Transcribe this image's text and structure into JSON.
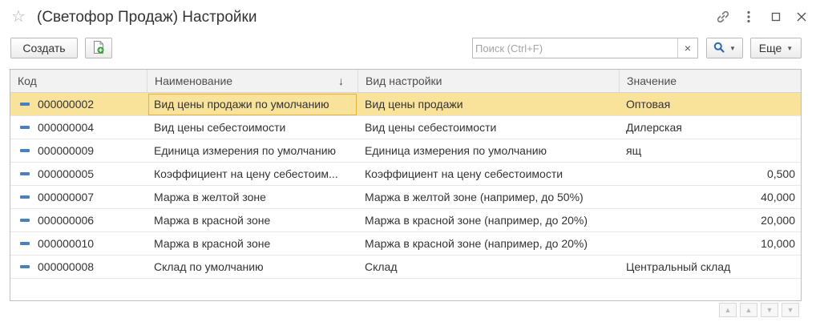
{
  "window": {
    "title": "(Светофор Продаж) Настройки"
  },
  "toolbar": {
    "create_label": "Создать",
    "search_placeholder": "Поиск (Ctrl+F)",
    "search_value": "",
    "clear_symbol": "×",
    "more_label": "Еще"
  },
  "table": {
    "columns": [
      "Код",
      "Наименование",
      "Вид настройки",
      "Значение"
    ],
    "sort_indicator": "↓",
    "rows": [
      {
        "code": "000000002",
        "name": "Вид цены продажи по умолчанию",
        "type": "Вид цены продажи",
        "value": "Оптовая",
        "numeric": false,
        "selected": true
      },
      {
        "code": "000000004",
        "name": "Вид цены себестоимости",
        "type": "Вид цены себестоимости",
        "value": "Дилерская",
        "numeric": false,
        "selected": false
      },
      {
        "code": "000000009",
        "name": "Единица измерения по умолчанию",
        "type": "Единица измерения по умолчанию",
        "value": "ящ",
        "numeric": false,
        "selected": false
      },
      {
        "code": "000000005",
        "name": "Коэффициент на цену себестоим...",
        "type": "Коэффициент на цену себестоимости",
        "value": "0,500",
        "numeric": true,
        "selected": false
      },
      {
        "code": "000000007",
        "name": "Маржа в желтой зоне",
        "type": "Маржа в желтой зоне (например, до 50%)",
        "value": "40,000",
        "numeric": true,
        "selected": false
      },
      {
        "code": "000000006",
        "name": "Маржа в красной зоне",
        "type": "Маржа в красной зоне (например, до 20%)",
        "value": "20,000",
        "numeric": true,
        "selected": false
      },
      {
        "code": "000000010",
        "name": "Маржа в красной зоне",
        "type": "Маржа в красной зоне (например, до 20%)",
        "value": "10,000",
        "numeric": true,
        "selected": false
      },
      {
        "code": "000000008",
        "name": "Склад по умолчанию",
        "type": "Склад",
        "value": "Центральный склад",
        "numeric": false,
        "selected": false
      }
    ]
  },
  "colors": {
    "selected_row": "#f9e29a",
    "focus_border": "#e8b240",
    "row_icon": "#4a7fc0",
    "accent": "#2a6ab0"
  },
  "icons": {
    "favorite": "star-icon",
    "link": "link-icon",
    "menu": "more-vertical-icon",
    "maximize": "maximize-icon",
    "close": "close-icon",
    "add_copy": "document-add-icon",
    "search": "search-icon"
  }
}
